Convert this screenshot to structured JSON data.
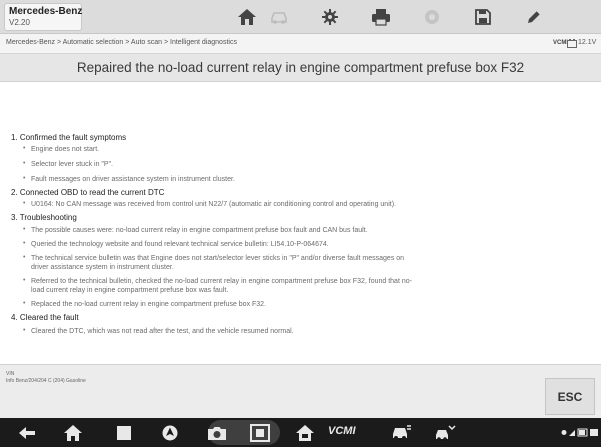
{
  "app": {
    "brand_title": "Mercedes-Benz",
    "version": "V2.20"
  },
  "toolbar_icons": [
    "home-icon",
    "vehicle-swap-icon",
    "gear-icon",
    "printer-icon",
    "help-icon",
    "save-icon",
    "pen-icon"
  ],
  "breadcrumb": "Mercedes-Benz > Automatic selection > Auto scan > Intelligent diagnostics",
  "status": {
    "vci_label": "VCMI",
    "voltage": "12.1V"
  },
  "page_title": "Repaired the no-load current relay in engine compartment prefuse box F32",
  "sections": [
    {
      "title": "1. Confirmed the fault symptoms",
      "items": [
        [
          "Engine does not start."
        ],
        [
          "Selector lever stuck in \"P\"."
        ],
        [
          "Fault messages on driver assistance system in instrument cluster."
        ]
      ]
    },
    {
      "title": "2. Connected OBD to read the current DTC",
      "items": [
        [
          "U0164: No CAN message was received from control unit N22/7 (automatic air conditioning control and operating unit)."
        ]
      ]
    },
    {
      "title": "3. Troubleshooting",
      "items": [
        [
          "The possible causes were: no-load current relay in engine compartment prefuse box fault and CAN bus fault."
        ],
        [
          "Queried the technology website and found relevant technical service bulletin: LI54.10-P-064674."
        ],
        [
          "The technical service bulletin was that Engine does not start/selector lever sticks in \"P\" and/or diverse fault messages on",
          "driver assistance system in instrument cluster."
        ],
        [
          "Referred to the technical bulletin, checked the no-load current relay in engine compartment prefuse box F32, found that no-",
          "load current relay in engine compartment prefuse box was fault."
        ],
        [
          "Replaced the no-load current relay in engine compartment prefuse box F32."
        ]
      ]
    },
    {
      "title": "4. Cleared the fault",
      "items": [
        [
          "Cleared the DTC, which was not read after the test, and the vehicle resumed normal."
        ]
      ]
    }
  ],
  "footer": {
    "vin_label": "VIN",
    "vehicle_info": "Info Benz/204/204 C (204) Gasoline",
    "esc_label": "ESC"
  },
  "navbar": {
    "vcmi_label": "VCMI",
    "icons": [
      "back-icon",
      "home-icon",
      "recent-apps-icon",
      "browser-icon",
      "camera-icon",
      "screenshot-icon",
      "car-home-icon",
      "vcmi-icon",
      "vehicle-connect-icon",
      "remote-support-icon",
      "system-status-icon"
    ]
  },
  "colors": {
    "toolbar_bg": "#dcdcdc",
    "navbar_bg": "#1b1b1b",
    "content_bg": "#ffffff"
  }
}
